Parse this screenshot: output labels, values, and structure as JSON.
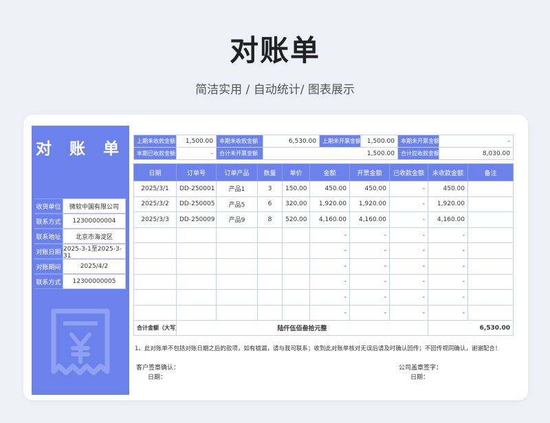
{
  "page": {
    "title": "对账单",
    "subtitle": "简洁实用 / 自动统计/ 图表展示"
  },
  "left": {
    "title": "对 账 单",
    "rows": [
      {
        "label": "收货单位",
        "value": "微软中国有限公司"
      },
      {
        "label": "联系方式",
        "value": "12300000004"
      },
      {
        "label": "联系地址",
        "value": "北京市海淀区"
      },
      {
        "label": "对账日期",
        "value": "2025-3-1至2025-3-31"
      },
      {
        "label": "对账期间",
        "value": "2025/4/2"
      },
      {
        "label": "联系方式",
        "value": "12300000005"
      }
    ],
    "icon": "receipt-yen-icon"
  },
  "summary": {
    "row1": [
      {
        "label": "上期未收款金额",
        "value": "1,500.00"
      },
      {
        "label": "本期未收款金额",
        "value": "6,530.00"
      },
      {
        "label": "上期未开票金额",
        "value": "1,500.00"
      },
      {
        "label": "本期未开票金额",
        "value": "-"
      }
    ],
    "row2": [
      {
        "label": "本期已收款金额",
        "value": "-"
      },
      {
        "label": "合计未开票金额",
        "value": "1,500.00"
      },
      {
        "label": "合计应收款金额",
        "value": "8,030.00"
      }
    ]
  },
  "table": {
    "headers": [
      "日期",
      "订单号",
      "订单产品",
      "数量",
      "单价",
      "金额",
      "开票金额",
      "已收款金额",
      "未收款金额",
      "备注"
    ],
    "rows": [
      [
        "2025/3/1",
        "DD-250001",
        "产品1",
        "3",
        "150.00",
        "450.00",
        "450.00",
        "-",
        "450.00",
        ""
      ],
      [
        "2025/3/2",
        "DD-250005",
        "产品5",
        "6",
        "320.00",
        "1,920.00",
        "1,920.00",
        "-",
        "1,920.00",
        ""
      ],
      [
        "2025/3/3",
        "DD-250009",
        "产品9",
        "8",
        "520.00",
        "4,160.00",
        "4,160.00",
        "-",
        "4,160.00",
        ""
      ],
      [
        "",
        "",
        "",
        "",
        "",
        "-",
        "-",
        "-",
        "-",
        ""
      ],
      [
        "",
        "",
        "",
        "",
        "",
        "-",
        "-",
        "-",
        "-",
        ""
      ],
      [
        "",
        "",
        "",
        "",
        "",
        "-",
        "-",
        "-",
        "-",
        ""
      ],
      [
        "",
        "",
        "",
        "",
        "",
        "-",
        "-",
        "-",
        "-",
        ""
      ],
      [
        "",
        "",
        "",
        "",
        "",
        "-",
        "-",
        "-",
        "-",
        ""
      ],
      [
        "",
        "",
        "",
        "",
        "",
        "-",
        "-",
        "-",
        "-",
        ""
      ]
    ],
    "total_label": "合计金额（大写）",
    "total_words": "陆仟伍佰叁拾元整",
    "total_value": "6,530.00"
  },
  "note": "1、此对账单不包括对账日期之后的款项，如有错漏，请与我司联系；收到此对账单核对无误后请及时确认回传；不回传视同确认，谢谢配合！",
  "signature": {
    "customer_label": "客户签章确认：",
    "customer_date": "日期：",
    "company_label": "公司盖章签字：",
    "company_date": "日期："
  },
  "colors": {
    "accent": "#6b82ec",
    "background": "#edf0f6"
  }
}
